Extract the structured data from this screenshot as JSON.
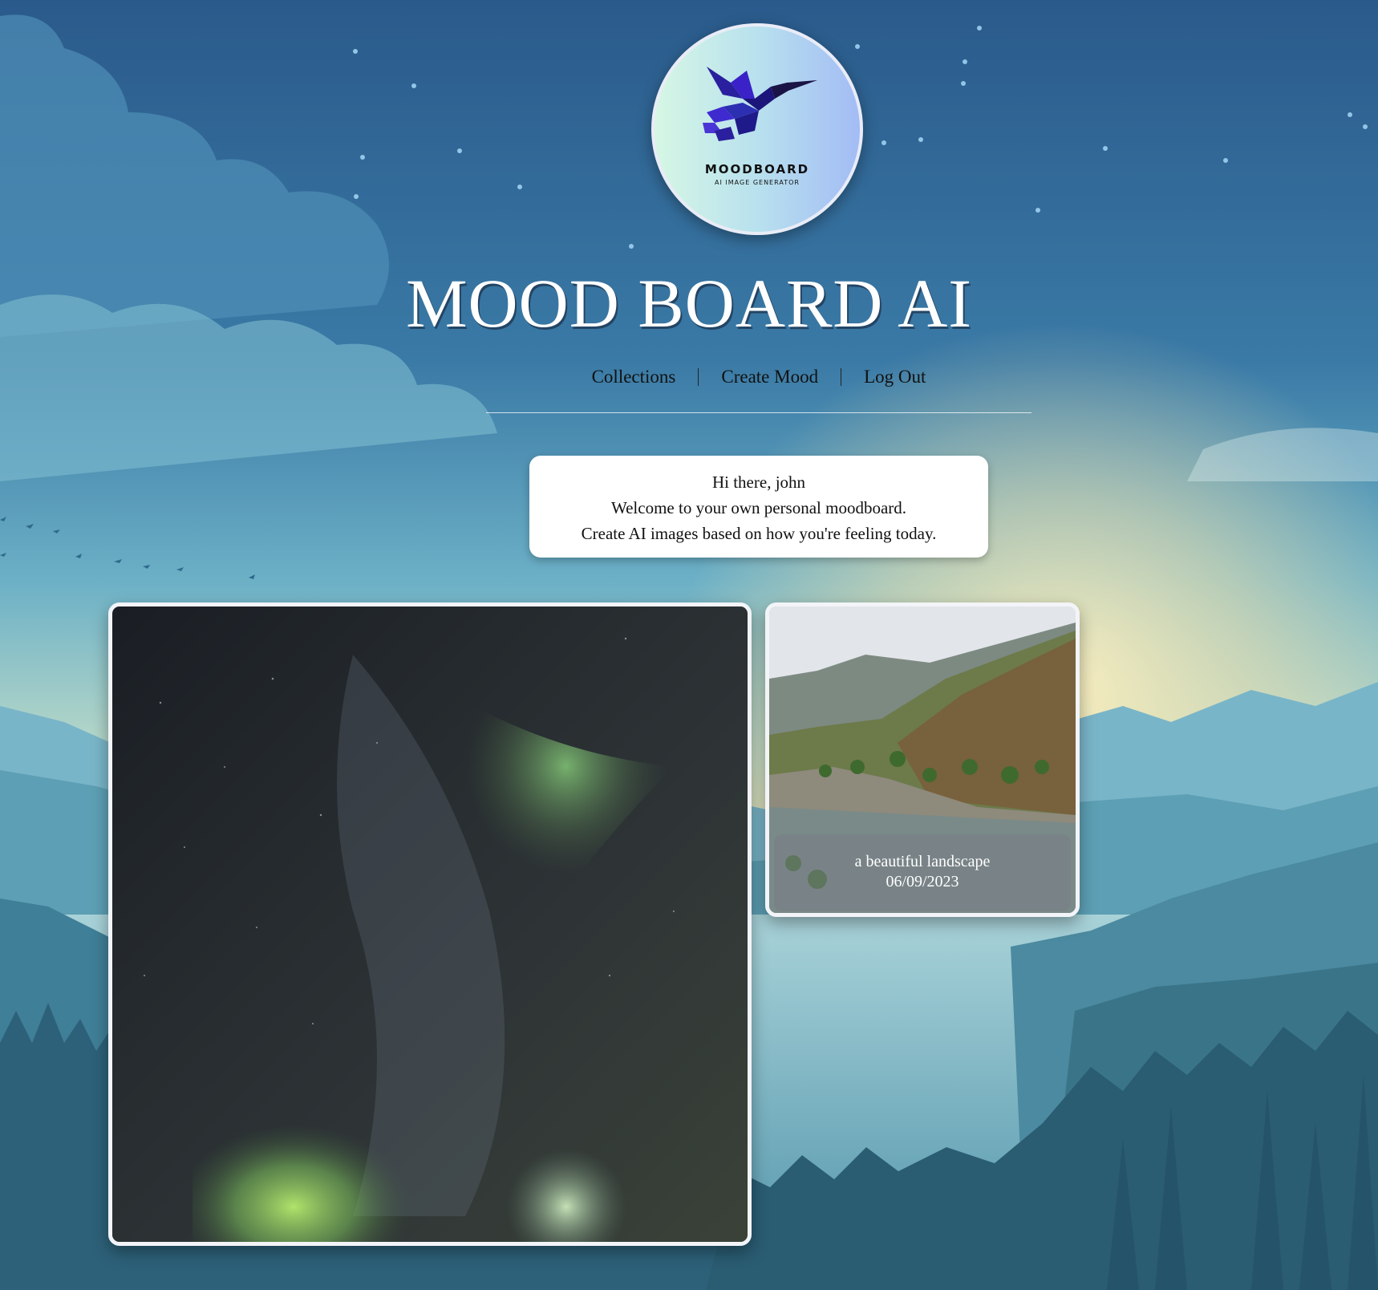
{
  "logo": {
    "name": "MOODBOARD",
    "tagline": "AI IMAGE GENERATOR",
    "icon": "hummingbird-icon"
  },
  "header": {
    "title": "MOOD BOARD AI"
  },
  "nav": {
    "items": [
      {
        "label": "Collections"
      },
      {
        "label": "Create Mood"
      },
      {
        "label": "Log Out"
      }
    ]
  },
  "welcome": {
    "greeting": "Hi there, john",
    "line1": "Welcome to your own personal moodboard.",
    "line2": "Create AI images based on how you're feeling today."
  },
  "gallery": {
    "items": [
      {
        "image": "aurora-borealis-night-sky"
      },
      {
        "image": "mountain-river-landscape",
        "caption": "a beautiful landscape",
        "date": "06/09/2023"
      }
    ]
  },
  "colors": {
    "sky_top": "#2c5f8e",
    "sky_mid": "#76b6c8",
    "glow": "#f3e4ad",
    "card_border": "#f2f4f8"
  }
}
